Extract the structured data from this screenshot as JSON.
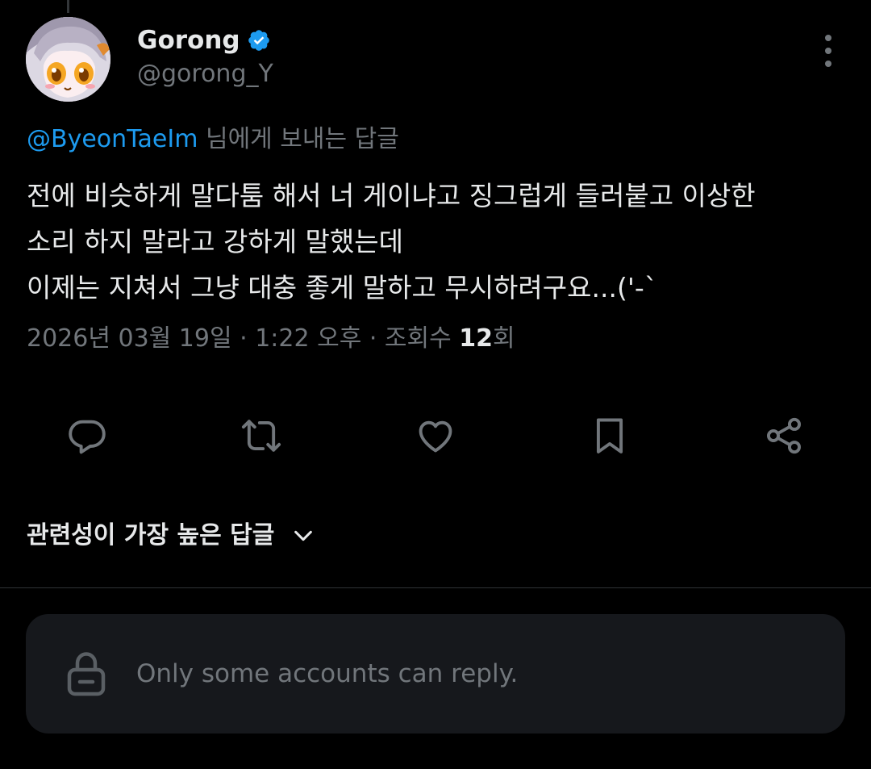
{
  "author": {
    "display_name": "Gorong",
    "handle": "@gorong_Y",
    "verified_icon": "verified-badge-icon",
    "avatar": "anime-character-avatar"
  },
  "reply_to": {
    "mention": "@ByeonTaeIm",
    "suffix": " 님에게 보내는 답글"
  },
  "tweet": {
    "lines": [
      "전에 비슷하게 말다툼 해서 너 게이냐고 징그럽게 들러붙고 이상한",
      "소리 하지 말라고 강하게 말했는데",
      "이제는 지쳐서 그냥 대충 좋게 말하고 무시하려구요...('-`"
    ]
  },
  "meta": {
    "date": "2026년 03월 19일",
    "separator": " · ",
    "time": "1:22 오후",
    "views_label": "조회수 ",
    "views_count": "12",
    "views_suffix": "회"
  },
  "actions": [
    {
      "name": "reply-icon"
    },
    {
      "name": "retweet-icon"
    },
    {
      "name": "like-icon"
    },
    {
      "name": "bookmark-icon"
    },
    {
      "name": "share-icon"
    }
  ],
  "replies_sort": {
    "label": "관련성이 가장 높은 답글",
    "icon": "chevron-down-icon"
  },
  "reply_restriction": {
    "text": "Only some accounts can reply.",
    "icon": "lock-icon"
  },
  "colors": {
    "background": "#000000",
    "text": "#e7e9ea",
    "secondary_text": "#71767b",
    "accent": "#1d9bf0",
    "panel": "#16181c",
    "divider": "#2f3336"
  }
}
